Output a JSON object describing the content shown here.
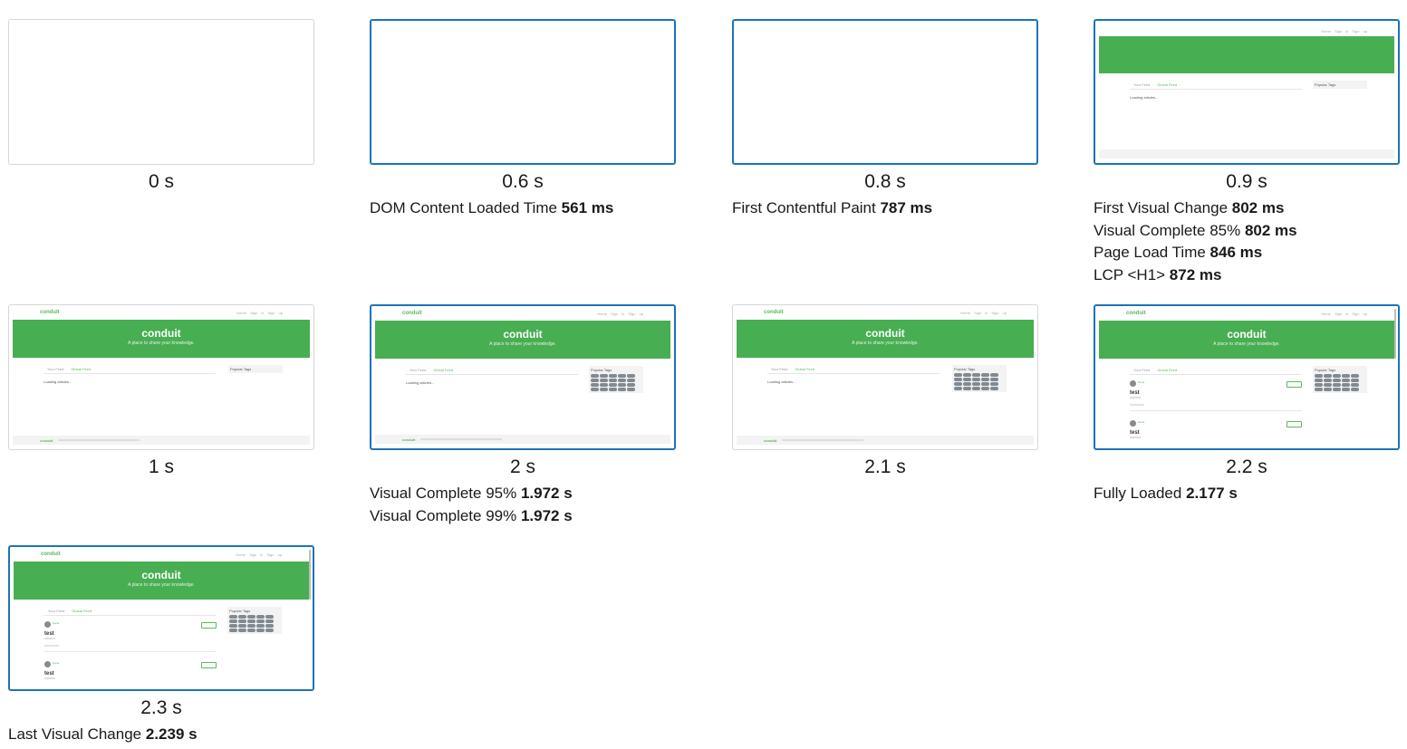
{
  "frames": [
    {
      "time": "0 s",
      "metrics": []
    },
    {
      "time": "0.6 s",
      "metrics": [
        {
          "label": "DOM Content Loaded Time ",
          "value": "561 ms"
        }
      ]
    },
    {
      "time": "0.8 s",
      "metrics": [
        {
          "label": "First Contentful Paint ",
          "value": "787 ms"
        }
      ]
    },
    {
      "time": "0.9 s",
      "metrics": [
        {
          "label": "First Visual Change ",
          "value": "802 ms"
        },
        {
          "label": "Visual Complete 85% ",
          "value": "802 ms"
        },
        {
          "label": "Page Load Time ",
          "value": "846 ms"
        },
        {
          "label": "LCP <H1> ",
          "value": "872 ms"
        }
      ]
    },
    {
      "time": "1 s",
      "metrics": []
    },
    {
      "time": "2 s",
      "metrics": [
        {
          "label": "Visual Complete 95% ",
          "value": "1.972 s"
        },
        {
          "label": "Visual Complete 99% ",
          "value": "1.972 s"
        }
      ]
    },
    {
      "time": "2.1 s",
      "metrics": []
    },
    {
      "time": "2.2 s",
      "metrics": [
        {
          "label": "Fully Loaded ",
          "value": "2.177 s"
        }
      ]
    },
    {
      "time": "2.3 s",
      "metrics": [
        {
          "label": "Last Visual Change ",
          "value": "2.239 s"
        }
      ]
    }
  ],
  "mini_page": {
    "brand": "conduit",
    "nav_links": "Home Sign in Sign up",
    "hero_title": "conduit",
    "hero_tagline": "A place to share your knowledge.",
    "tab_your_feed": "Your Feed",
    "tab_global_feed": "Global Feed",
    "loading": "Loading articles...",
    "popular_tags": "Popular Tags",
    "article_author": "Hana",
    "article_title": "test",
    "footer_brand": "conduit"
  },
  "colors": {
    "changed_border": "#1b74b8",
    "brand_green": "#47ae52"
  }
}
